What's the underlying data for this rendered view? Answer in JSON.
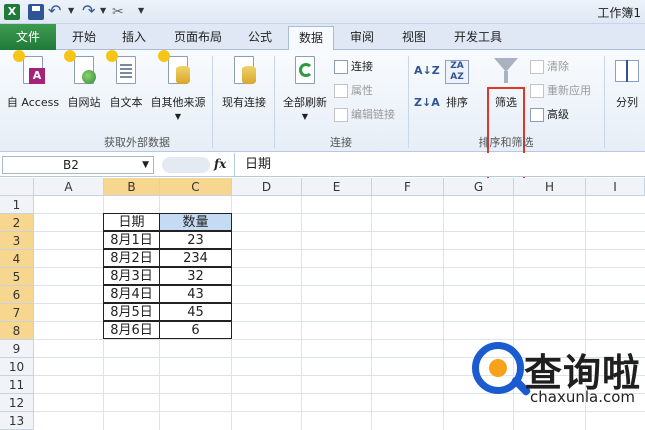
{
  "window": {
    "title": "工作簿1"
  },
  "tabs": [
    {
      "label": "文件"
    },
    {
      "label": "开始"
    },
    {
      "label": "插入"
    },
    {
      "label": "页面布局"
    },
    {
      "label": "公式"
    },
    {
      "label": "数据"
    },
    {
      "label": "审阅"
    },
    {
      "label": "视图"
    },
    {
      "label": "开发工具"
    }
  ],
  "active_tab": "数据",
  "ribbon": {
    "groups": {
      "external": {
        "label": "获取外部数据",
        "buttons": [
          "自 Access",
          "自网站",
          "自文本",
          "自其他来源",
          "现有连接"
        ]
      },
      "connections": {
        "label": "连接",
        "refresh": "全部刷新",
        "connect": "连接",
        "properties": "属性",
        "edit_links": "编辑链接"
      },
      "sort_filter": {
        "label": "排序和筛选",
        "sort": "排序",
        "filter": "筛选",
        "clear": "清除",
        "reapply": "重新应用",
        "advanced": "高级"
      },
      "tools": {
        "split": "分列"
      }
    }
  },
  "formula_bar": {
    "name_box": "B2",
    "fx": "fx",
    "content": "日期"
  },
  "grid": {
    "columns": [
      "A",
      "B",
      "C",
      "D",
      "E",
      "F",
      "G",
      "H",
      "I"
    ],
    "rows": [
      "1",
      "2",
      "3",
      "4",
      "5",
      "6",
      "7",
      "8",
      "9",
      "10",
      "11",
      "12",
      "13"
    ],
    "table": {
      "headers": [
        "日期",
        "数量"
      ],
      "rows": [
        [
          "8月1日",
          "23"
        ],
        [
          "8月2日",
          "234"
        ],
        [
          "8月3日",
          "32"
        ],
        [
          "8月4日",
          "43"
        ],
        [
          "8月5日",
          "45"
        ],
        [
          "8月6日",
          "6"
        ]
      ]
    }
  },
  "watermark": {
    "text": "查询啦",
    "url": "chaxunla.com"
  },
  "colors": {
    "accent_green": "#1f7a3a",
    "highlight_red": "#e0352b",
    "selection": "#f7d78f"
  }
}
